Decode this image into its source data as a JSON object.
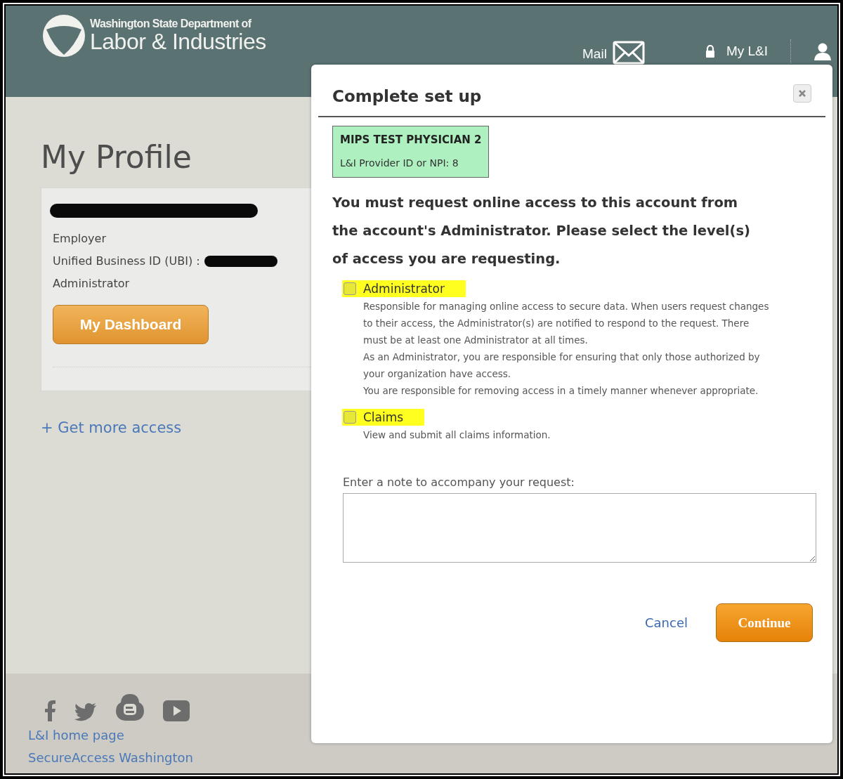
{
  "header": {
    "agency_line": "Washington State Department of",
    "agency_name": "Labor & Industries",
    "nav": [
      {
        "kind": "mail",
        "label": "Mail"
      },
      {
        "kind": "account",
        "label": "My L&I"
      },
      {
        "kind": "user"
      }
    ]
  },
  "profile": {
    "title": "My Profile",
    "card": {
      "redacted": true,
      "lines": [
        {
          "text": "Employer",
          "redacted": false
        },
        {
          "text": "Unified Business ID (UBI) :",
          "redacted": true
        },
        {
          "text": "Administrator",
          "redacted": false
        }
      ],
      "button": "My Dashboard"
    },
    "more_link": "+ Get more access"
  },
  "footer": {
    "social": [
      {
        "kind": "facebook"
      },
      {
        "kind": "twitter"
      },
      {
        "kind": "blogger"
      },
      {
        "kind": "youtube"
      }
    ],
    "links": [
      "L&I home page",
      "SecureAccess Washington"
    ]
  },
  "modal": {
    "title": "Complete set up",
    "account": {
      "name": "MIPS TEST PHYSICIAN 2",
      "id_line": "L&I Provider ID or NPI: 8"
    },
    "message": "You must request online access to this account from the account's Administrator. Please select the level(s) of access you are requesting.",
    "options": [
      {
        "label": "Administrator",
        "checked": false,
        "highlighted": true,
        "description": [
          "Responsible for managing online access to secure data. When users request changes to their access, the Administrator(s) are notified to respond to the request. There must be at least one Administrator at all times.",
          "As an Administrator, you are responsible for ensuring that only those authorized by your organization have access.",
          "You are responsible for removing access in a timely manner whenever appropriate."
        ]
      },
      {
        "label": "Claims",
        "checked": false,
        "highlighted": true,
        "description": [
          "View and submit all claims information."
        ]
      }
    ],
    "note_label": "Enter a note to accompany your request:",
    "cancel": "Cancel",
    "continue": "Continue"
  }
}
